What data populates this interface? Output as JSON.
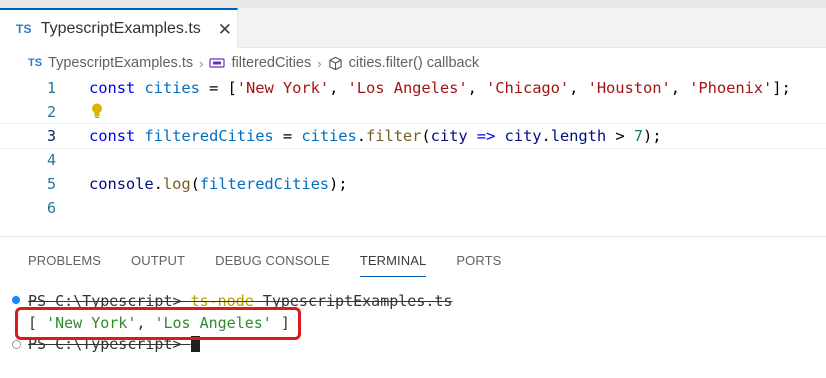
{
  "tab": {
    "badge": "TS",
    "label": "TypescriptExamples.ts",
    "close": "✕"
  },
  "breadcrumb": {
    "badge": "TS",
    "file": "TypescriptExamples.ts",
    "sep1": "›",
    "variable": "filteredCities",
    "sep2": "›",
    "method": "cities.filter() callback"
  },
  "editor": {
    "lines": [
      {
        "number": "1",
        "text": "const cities = ['New York', 'Los Angeles', 'Chicago', 'Houston', 'Phoenix'];"
      },
      {
        "number": "2",
        "text": ""
      },
      {
        "number": "3",
        "text": "const filteredCities = cities.filter(city => city.length > 7);"
      },
      {
        "number": "4",
        "text": ""
      },
      {
        "number": "5",
        "text": "console.log(filteredCities);"
      },
      {
        "number": "6",
        "text": ""
      }
    ],
    "tokens": {
      "l1": {
        "k": "const",
        "v": "cities",
        "op": " = [",
        "s1": "'New York'",
        "c1": ", ",
        "s2": "'Los Angeles'",
        "c2": ", ",
        "s3": "'Chicago'",
        "c3": ", ",
        "s4": "'Houston'",
        "c4": ", ",
        "s5": "'Phoenix'",
        "end": "];"
      },
      "l3": {
        "k": "const",
        "v": "filteredCities",
        "op": " = ",
        "obj": "cities",
        "dot": ".",
        "fn": "filter",
        "p1": "(",
        "param": "city",
        "arrow": " => ",
        "p2": "city",
        "dot2": ".",
        "prop": "length",
        "gt": " > ",
        "num": "7",
        "end": ");"
      },
      "l5": {
        "obj": "console",
        "dot": ".",
        "fn": "log",
        "p1": "(",
        "arg": "filteredCities",
        "end": ");"
      }
    }
  },
  "panel": {
    "tabs": [
      "PROBLEMS",
      "OUTPUT",
      "DEBUG CONSOLE",
      "TERMINAL",
      "PORTS"
    ],
    "active_tab": "TERMINAL"
  },
  "terminal": {
    "prompt1": "PS C:\\Typescript> ",
    "command": "ts-node",
    "command_arg": " TypescriptExamples.ts",
    "out_open": "[ ",
    "out_s1": "'New York'",
    "out_comma": ", ",
    "out_s2": "'Los Angeles'",
    "out_close": " ]",
    "prompt2": "PS C:\\Typescript> "
  },
  "colors": {
    "accent": "#005fb8",
    "highlight_box": "#d81b1b",
    "ts_blue": "#3178c6"
  }
}
